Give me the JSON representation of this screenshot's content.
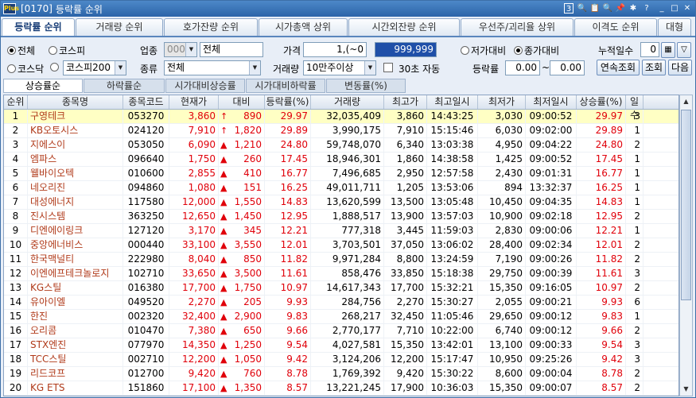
{
  "window": {
    "code": "[0170]",
    "title": "등락률 순위",
    "title_icons": [
      "3",
      "🔍",
      "📋",
      "🔍",
      "📌",
      "✱",
      "?"
    ],
    "min": "_",
    "max": "□",
    "close": "✕",
    "logo": "Plus"
  },
  "tabs": [
    "등락률 순위",
    "거래량 순위",
    "호가잔량 순위",
    "시가총액 상위",
    "시간외잔량 순위",
    "우선주/괴리율 상위",
    "이격도 순위",
    "대형"
  ],
  "filters": {
    "market_all": "전체",
    "market_kospi": "코스피",
    "market_kosdaq": "코스닥",
    "index_value": "코스피200",
    "sector_label": "업종",
    "sector_code": "0000",
    "sector_name": "전체",
    "kind_label": "종류",
    "kind_value": "전체",
    "price_label": "가격",
    "price_from": "1,(~0",
    "price_to": "999,999",
    "volume_label": "거래량",
    "volume_value": "10만주이상",
    "auto_label": "30초 자동",
    "low_vs": "저가대비",
    "close_vs": "종가대비",
    "change_label": "등락률",
    "change_from": "0.00",
    "change_sep": "~",
    "change_to": "0.00",
    "days_label": "누적일수",
    "days_value": "0",
    "continue_btn": "연속조회",
    "query_btn": "조회",
    "next_btn": "다음"
  },
  "subtabs": [
    "상승률순",
    "하락률순",
    "시가대비상승률",
    "시가대비하락률",
    "변동률(%)"
  ],
  "columns": [
    "순위",
    "종목명",
    "종목코드",
    "현재가",
    "대비",
    "등락률(%)",
    "거래량",
    "최고가",
    "최고일시",
    "최저가",
    "최저일시",
    "상승률(%)",
    "일수"
  ],
  "rows": [
    [
      "1",
      "구영테크",
      "053270",
      "3,860",
      "890",
      "29.97",
      "32,035,409",
      "3,860",
      "14:43:25",
      "3,030",
      "09:00:52",
      "29.97",
      "3"
    ],
    [
      "2",
      "KB오토시스",
      "024120",
      "7,910",
      "1,820",
      "29.89",
      "3,990,175",
      "7,910",
      "15:15:46",
      "6,030",
      "09:02:00",
      "29.89",
      "1"
    ],
    [
      "3",
      "지에스이",
      "053050",
      "6,090",
      "1,210",
      "24.80",
      "59,748,070",
      "6,340",
      "13:03:38",
      "4,950",
      "09:04:22",
      "24.80",
      "2"
    ],
    [
      "4",
      "엠파스",
      "096640",
      "1,750",
      "260",
      "17.45",
      "18,946,301",
      "1,860",
      "14:38:58",
      "1,425",
      "09:00:52",
      "17.45",
      "1"
    ],
    [
      "5",
      "웰바이오텍",
      "010600",
      "2,855",
      "410",
      "16.77",
      "7,496,685",
      "2,950",
      "12:57:58",
      "2,430",
      "09:01:31",
      "16.77",
      "1"
    ],
    [
      "6",
      "네오리진",
      "094860",
      "1,080",
      "151",
      "16.25",
      "49,011,711",
      "1,205",
      "13:53:06",
      "894",
      "13:32:37",
      "16.25",
      "1"
    ],
    [
      "7",
      "대성에너지",
      "117580",
      "12,000",
      "1,550",
      "14.83",
      "13,620,599",
      "13,500",
      "13:05:48",
      "10,450",
      "09:04:35",
      "14.83",
      "1"
    ],
    [
      "8",
      "진시스템",
      "363250",
      "12,650",
      "1,450",
      "12.95",
      "1,888,517",
      "13,900",
      "13:57:03",
      "10,900",
      "09:02:18",
      "12.95",
      "2"
    ],
    [
      "9",
      "디엔에이링크",
      "127120",
      "3,170",
      "345",
      "12.21",
      "777,318",
      "3,445",
      "11:59:03",
      "2,830",
      "09:00:06",
      "12.21",
      "1"
    ],
    [
      "10",
      "중앙에너비스",
      "000440",
      "33,100",
      "3,550",
      "12.01",
      "3,703,501",
      "37,050",
      "13:06:02",
      "28,400",
      "09:02:34",
      "12.01",
      "2"
    ],
    [
      "11",
      "한국맥널티",
      "222980",
      "8,040",
      "850",
      "11.82",
      "9,971,284",
      "8,800",
      "13:24:59",
      "7,190",
      "09:00:26",
      "11.82",
      "2"
    ],
    [
      "12",
      "이엔에프테크놀로지",
      "102710",
      "33,650",
      "3,500",
      "11.61",
      "858,476",
      "33,850",
      "15:18:38",
      "29,750",
      "09:00:39",
      "11.61",
      "3"
    ],
    [
      "13",
      "KG스틸",
      "016380",
      "17,700",
      "1,750",
      "10.97",
      "14,617,343",
      "17,700",
      "15:32:21",
      "15,350",
      "09:16:05",
      "10.97",
      "2"
    ],
    [
      "14",
      "유아이엘",
      "049520",
      "2,270",
      "205",
      "9.93",
      "284,756",
      "2,270",
      "15:30:27",
      "2,055",
      "09:00:21",
      "9.93",
      "6"
    ],
    [
      "15",
      "한진",
      "002320",
      "32,400",
      "2,900",
      "9.83",
      "268,217",
      "32,450",
      "11:05:46",
      "29,650",
      "09:00:12",
      "9.83",
      "1"
    ],
    [
      "16",
      "오리콤",
      "010470",
      "7,380",
      "650",
      "9.66",
      "2,770,177",
      "7,710",
      "10:22:00",
      "6,740",
      "09:00:12",
      "9.66",
      "2"
    ],
    [
      "17",
      "STX엔진",
      "077970",
      "14,350",
      "1,250",
      "9.54",
      "4,027,581",
      "15,350",
      "13:42:01",
      "13,100",
      "09:00:33",
      "9.54",
      "3"
    ],
    [
      "18",
      "TCC스틸",
      "002710",
      "12,200",
      "1,050",
      "9.42",
      "3,124,206",
      "12,200",
      "15:17:47",
      "10,950",
      "09:25:26",
      "9.42",
      "3"
    ],
    [
      "19",
      "리드코프",
      "012700",
      "9,420",
      "760",
      "8.78",
      "1,769,392",
      "9,420",
      "15:30:22",
      "8,600",
      "09:00:04",
      "8.78",
      "2"
    ],
    [
      "20",
      "KG ETS",
      "151860",
      "17,100",
      "1,350",
      "8.57",
      "13,221,245",
      "17,900",
      "10:36:03",
      "15,350",
      "09:00:07",
      "8.57",
      "2"
    ]
  ],
  "upper_limit_rows": [
    0,
    1
  ],
  "colors": {
    "up": "#e0000a",
    "name": "#b03a1a",
    "selected_row": "#ffffc4",
    "title_bar": "#2b64a8"
  }
}
